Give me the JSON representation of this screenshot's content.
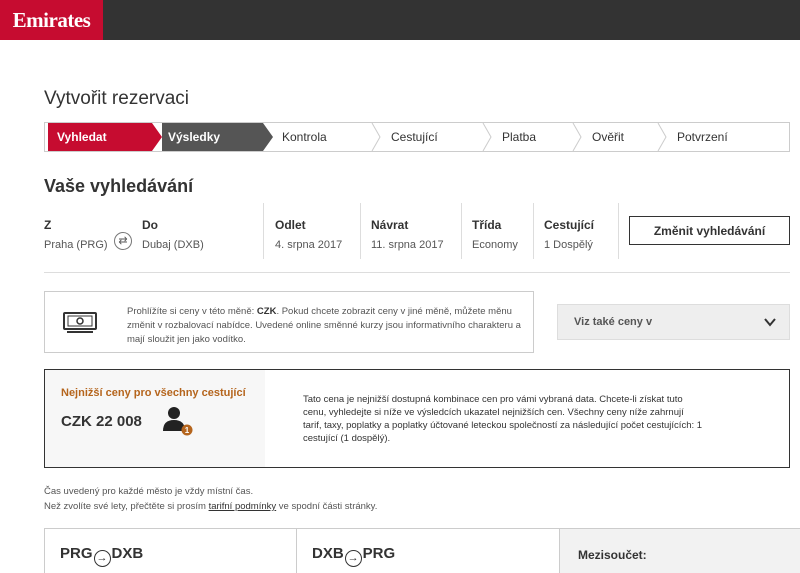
{
  "brand": {
    "logo_text": "Emirates",
    "primary_color": "#c60c30",
    "topbar_color": "#333333"
  },
  "page": {
    "title": "Vytvořit rezervaci"
  },
  "steps": [
    {
      "label": "Vyhledat",
      "state": "active"
    },
    {
      "label": "Výsledky",
      "state": "done"
    },
    {
      "label": "Kontrola",
      "state": "pending"
    },
    {
      "label": "Cestující",
      "state": "pending"
    },
    {
      "label": "Platba",
      "state": "pending"
    },
    {
      "label": "Ověřit",
      "state": "pending"
    },
    {
      "label": "Potvrzení",
      "state": "pending"
    }
  ],
  "search": {
    "title": "Vaše vyhledávání",
    "from": {
      "label": "Z",
      "value": "Praha (PRG)"
    },
    "to": {
      "label": "Do",
      "value": "Dubaj (DXB)"
    },
    "depart": {
      "label": "Odlet",
      "value": "4. srpna 2017"
    },
    "return": {
      "label": "Návrat",
      "value": "11. srpna 2017"
    },
    "class": {
      "label": "Třída",
      "value": "Economy"
    },
    "passengers": {
      "label": "Cestující",
      "value": "1 Dospělý"
    },
    "swap_icon": "swap-arrows-icon",
    "change_button": "Změnit vyhledávání"
  },
  "currency": {
    "icon": "banknote-icon",
    "text_before": "Prohlížíte si ceny v této měně: ",
    "currency_code": "CZK",
    "text_after": ". Pokud chcete zobrazit ceny v jiné měně, můžete měnu změnit v rozbalovací nabídce. Uvedené online směnné kurzy jsou informativního charakteru a mají sloužit jen jako vodítko.",
    "select_label": "Viz také ceny v"
  },
  "lowest": {
    "title": "Nejnižší ceny pro všechny cestující",
    "price": "CZK 22 008",
    "pax_badge": "1",
    "description": "Tato cena je nejnižší dostupná kombinace cen pro vámi vybraná data. Chcete-li získat tuto cenu, vyhledejte si níže ve výsledcích ukazatel nejnižších cen. Všechny ceny níže zahrnují tarif, taxy, poplatky a poplatky účtované leteckou společností za následující počet cestujících: 1 cestující (1 dospělý).",
    "title_color": "#b5651d"
  },
  "notes": {
    "time_note": "Čas uvedený pro každé město je vždy místní čas.",
    "terms_before": "Než zvolíte své lety, přečtěte si prosím ",
    "terms_link": "tarifní podmínky",
    "terms_after": " ve spodní části stránky."
  },
  "routes": {
    "outbound": {
      "from": "PRG",
      "to": "DXB"
    },
    "inbound": {
      "from": "DXB",
      "to": "PRG"
    },
    "subtotal_label": "Mezisoučet:"
  }
}
